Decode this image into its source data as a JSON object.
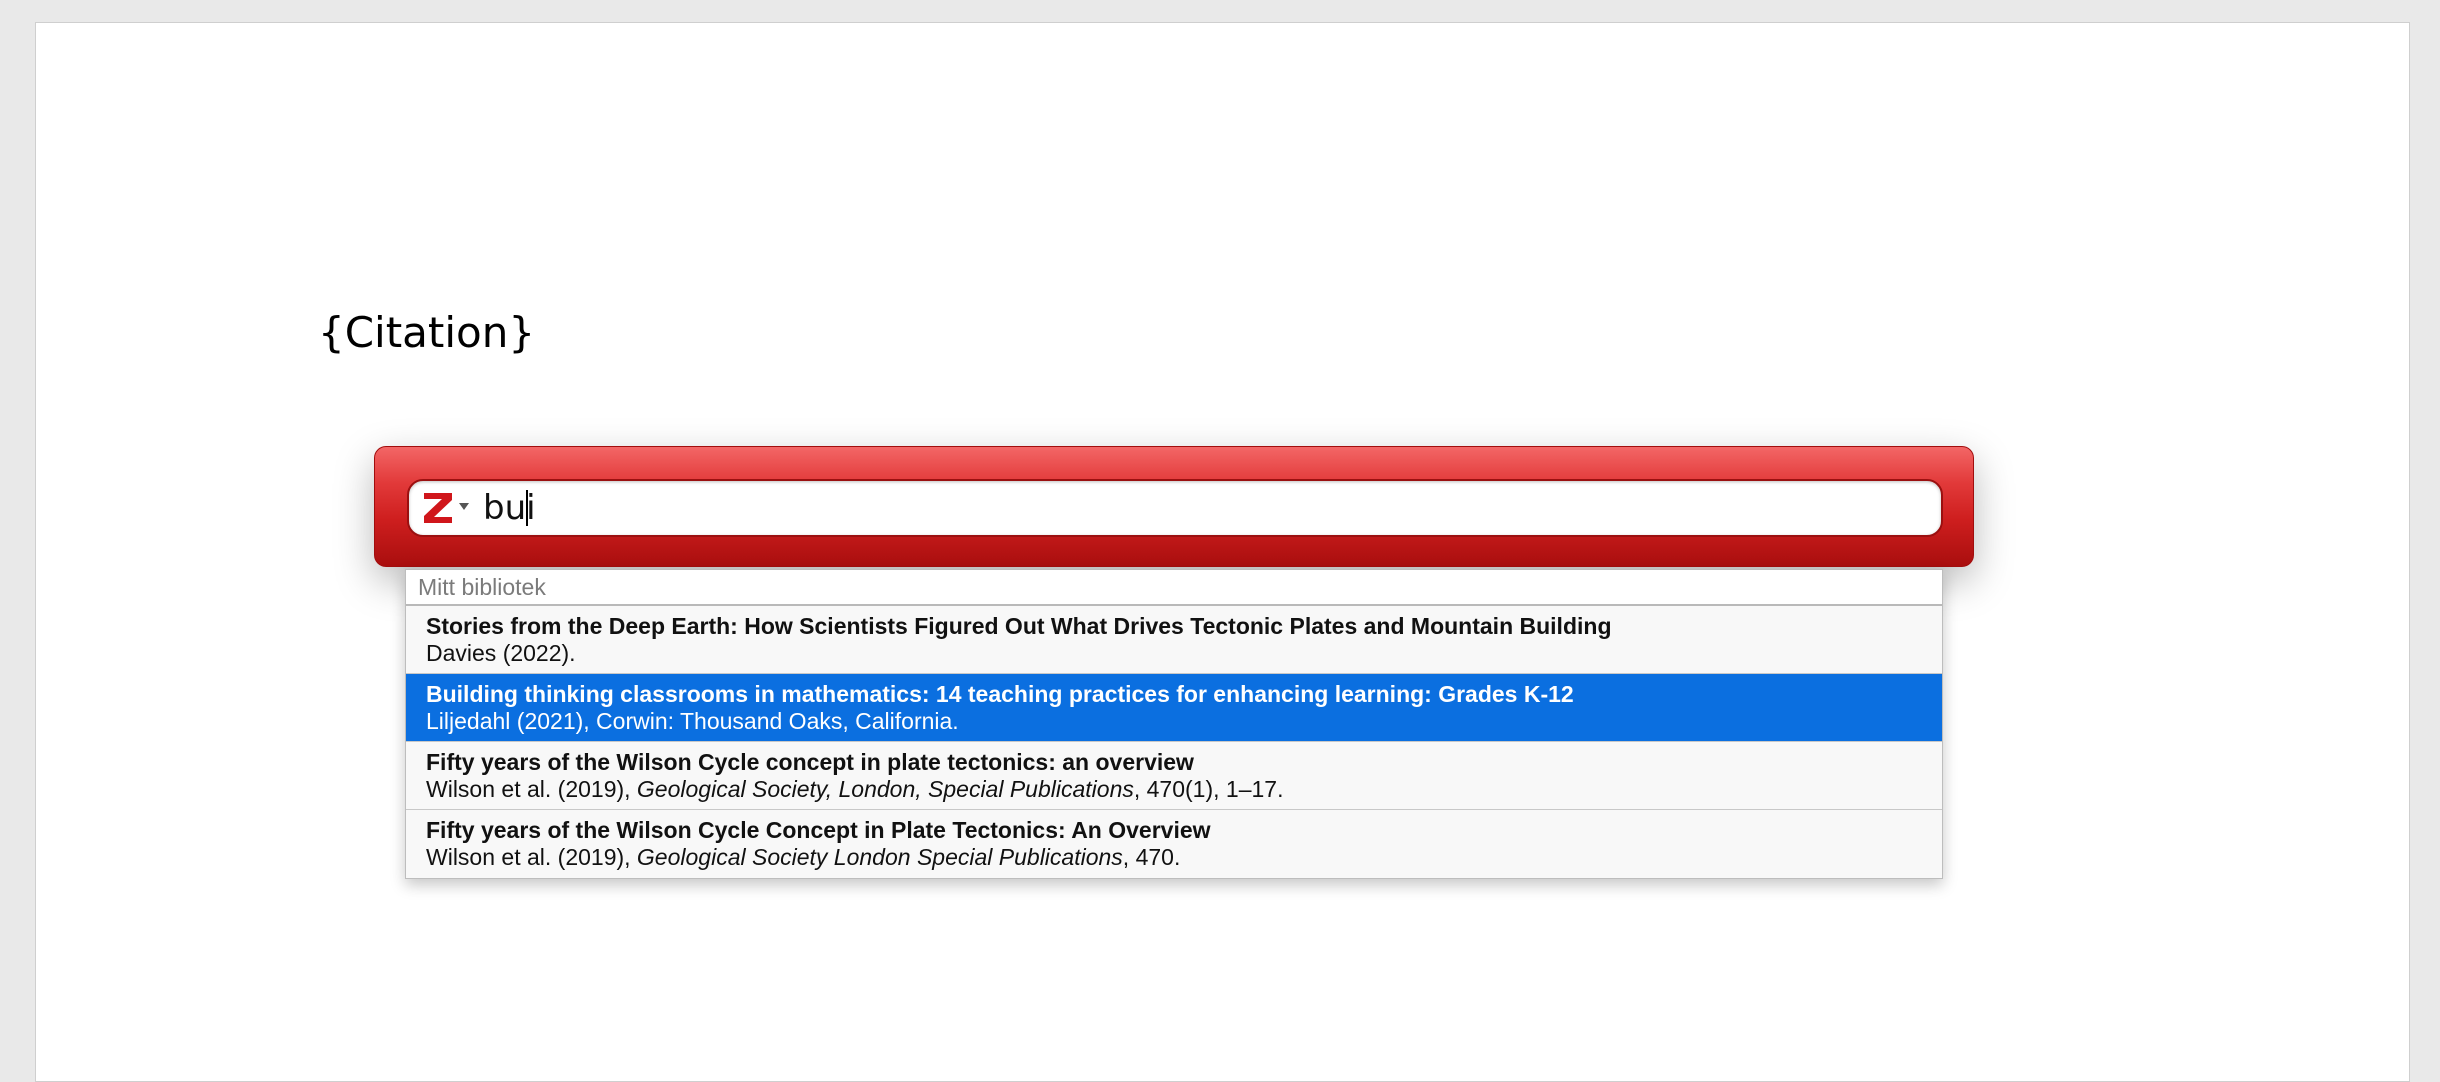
{
  "document": {
    "citation_placeholder": "{Citation}"
  },
  "quick_format": {
    "menu_icon": "zotero-z-icon",
    "search_value": "bui",
    "brand_color": "#d32727"
  },
  "results": {
    "section_label": "Mitt bibliotek",
    "selected_color": "#0b6fe0",
    "items": [
      {
        "title": "Stories from the Deep Earth: How Scientists Figured Out What Drives Tectonic Plates and Mountain Building",
        "meta_prefix": "Davies (2022).",
        "meta_journal": "",
        "meta_suffix": ""
      },
      {
        "title": "Building thinking classrooms in mathematics: 14 teaching practices for enhancing learning: Grades K-12",
        "meta_prefix": "Liljedahl (2021), Corwin: Thousand Oaks, California.",
        "meta_journal": "",
        "meta_suffix": ""
      },
      {
        "title": "Fifty years of the Wilson Cycle concept in plate tectonics: an overview",
        "meta_prefix": "Wilson et al. (2019), ",
        "meta_journal": "Geological Society, London, Special Publications",
        "meta_suffix": ", 470(1), 1–17."
      },
      {
        "title": "Fifty years of the Wilson Cycle Concept in Plate Tectonics: An Overview",
        "meta_prefix": "Wilson et al. (2019), ",
        "meta_journal": "Geological Society London Special Publications",
        "meta_suffix": ", 470."
      }
    ]
  }
}
